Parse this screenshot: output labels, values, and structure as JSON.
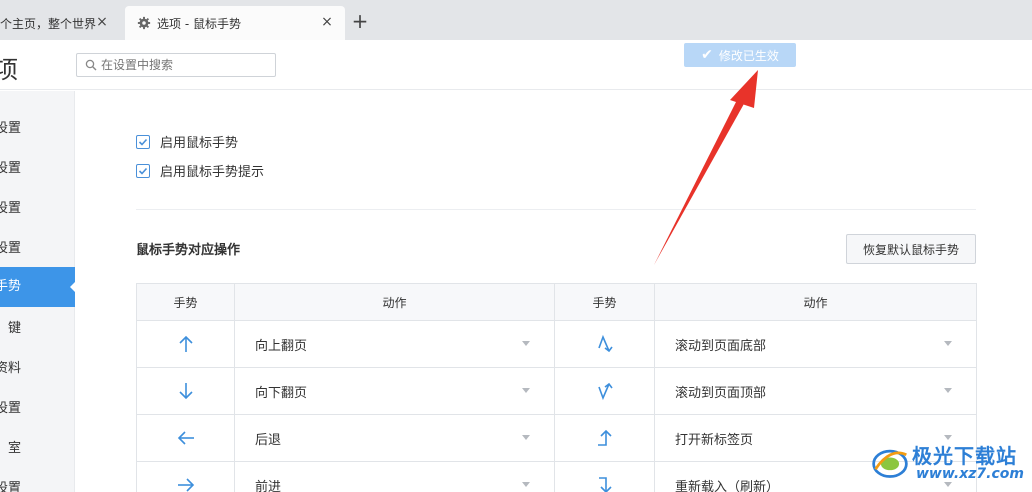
{
  "tabs": [
    {
      "title": "个主页，整个世界",
      "active": false
    },
    {
      "title": "选项 - 鼠标手势",
      "active": true
    }
  ],
  "tab_close_glyph": "×",
  "new_tab_glyph": "+",
  "header": {
    "title": "项",
    "search_placeholder": "在设置中搜索",
    "toast": "修改已生效"
  },
  "sidebar": {
    "items": [
      {
        "label": "设置"
      },
      {
        "label": "设置"
      },
      {
        "label": "设置"
      },
      {
        "label": "设置"
      },
      {
        "label": "手势",
        "active": true
      },
      {
        "label": "键"
      },
      {
        "label": "资料"
      },
      {
        "label": "设置"
      },
      {
        "label": "室"
      },
      {
        "label": "安全设置"
      }
    ]
  },
  "options": {
    "enable_gesture": {
      "label": "启用鼠标手势",
      "checked": true
    },
    "enable_gesture_hint": {
      "label": "启用鼠标手势提示",
      "checked": true
    }
  },
  "section": {
    "title": "鼠标手势对应操作",
    "restore_button": "恢复默认鼠标手势"
  },
  "table": {
    "headers": [
      "手势",
      "动作",
      "手势",
      "动作"
    ],
    "rows": [
      {
        "left_icon": "arrow-up-icon",
        "left_action": "向上翻页",
        "right_icon": "gesture-up-down-icon",
        "right_action": "滚动到页面底部"
      },
      {
        "left_icon": "arrow-down-icon",
        "left_action": "向下翻页",
        "right_icon": "gesture-down-up-icon",
        "right_action": "滚动到页面顶部"
      },
      {
        "left_icon": "arrow-left-icon",
        "left_action": "后退",
        "right_icon": "gesture-right-up-icon",
        "right_action": "打开新标签页"
      },
      {
        "left_icon": "arrow-right-icon",
        "left_action": "前进",
        "right_icon": "gesture-down-right-icon",
        "right_action": "重新载入（刷新）"
      }
    ]
  },
  "watermark": {
    "name": "极光下载站",
    "url": "www.xz7.com"
  },
  "colors": {
    "accent": "#3d95e8",
    "toast": "#b8d7f7",
    "annotation": "#e8332a"
  }
}
